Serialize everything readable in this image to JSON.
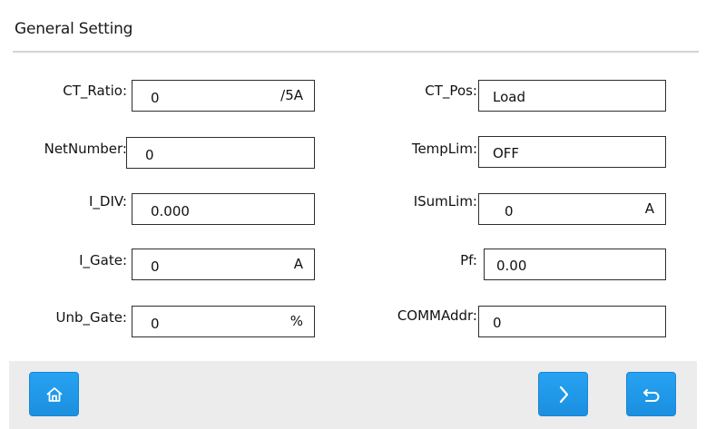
{
  "header": {
    "title": "General Setting"
  },
  "left_fields": [
    {
      "label": "CT_Ratio:",
      "value": "0",
      "unit": "/5A"
    },
    {
      "label": "NetNumber:",
      "value": "0",
      "unit": ""
    },
    {
      "label": "I_DIV:",
      "value": "0.000",
      "unit": ""
    },
    {
      "label": "I_Gate:",
      "value": "0",
      "unit": "A"
    },
    {
      "label": "Unb_Gate:",
      "value": "0",
      "unit": "%"
    }
  ],
  "right_fields": [
    {
      "label": "CT_Pos:",
      "value": "Load",
      "unit": ""
    },
    {
      "label": "TempLim:",
      "value": "OFF",
      "unit": ""
    },
    {
      "label": "ISumLim:",
      "value": "0",
      "unit": "A"
    },
    {
      "label": "Pf:",
      "value": "0.00",
      "unit": ""
    },
    {
      "label": "COMMAddr:",
      "value": "0",
      "unit": ""
    }
  ],
  "toolbar": {
    "home_icon": "home-icon",
    "next_icon": "chevron-right-icon",
    "back_icon": "return-icon"
  },
  "colors": {
    "button_blue": "#1e96e8",
    "bottom_bar": "#ececec",
    "divider": "#d4d4d4"
  }
}
